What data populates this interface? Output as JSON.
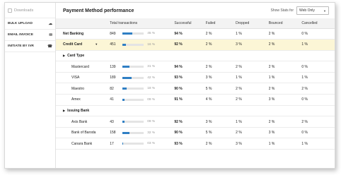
{
  "sidebar": {
    "top_label": "Downloads",
    "items": [
      {
        "label": "BULK UPLOAD",
        "icon": "cloud-upload-icon"
      },
      {
        "label": "EMAIL INVOICE",
        "icon": "email-icon"
      },
      {
        "label": "INITIATE BY IVR",
        "icon": "phone-icon"
      }
    ]
  },
  "header": {
    "title": "Payment Method performance",
    "stats_label": "Show Stats for",
    "stats_value": "Web Only"
  },
  "table": {
    "columns": [
      "",
      "Total transactions",
      "Successful",
      "Failed",
      "Dropped",
      "Bounced",
      "Cancelled"
    ],
    "rows": [
      {
        "kind": "main",
        "label": "Net Banking",
        "count": "849",
        "pct": "45 %",
        "frac": 0.45,
        "successful": "94 %",
        "failed": "2 %",
        "dropped": "1 %",
        "bounced": "2 %",
        "cancelled": "0 %"
      },
      {
        "kind": "highlight",
        "label": "Credit Card",
        "count": "451",
        "pct": "16 %",
        "frac": 0.16,
        "successful": "92 %",
        "failed": "2 %",
        "dropped": "3 %",
        "bounced": "2 %",
        "cancelled": "1 %"
      },
      {
        "kind": "group",
        "label": "Card Type"
      },
      {
        "kind": "sub",
        "label": "Mastercard",
        "count": "139",
        "pct": "31 %",
        "frac": 0.31,
        "successful": "94 %",
        "failed": "2 %",
        "dropped": "2 %",
        "bounced": "2 %",
        "cancelled": "0 %"
      },
      {
        "kind": "sub",
        "label": "VISA",
        "count": "189",
        "pct": "42 %",
        "frac": 0.42,
        "successful": "93 %",
        "failed": "3 %",
        "dropped": "1 %",
        "bounced": "1 %",
        "cancelled": "1 %"
      },
      {
        "kind": "sub",
        "label": "Maestro",
        "count": "82",
        "pct": "18 %",
        "frac": 0.18,
        "successful": "90 %",
        "failed": "5 %",
        "dropped": "2 %",
        "bounced": "2 %",
        "cancelled": "2 %"
      },
      {
        "kind": "sub",
        "label": "Amex",
        "count": "41",
        "pct": "09 %",
        "frac": 0.09,
        "successful": "91 %",
        "failed": "4 %",
        "dropped": "2 %",
        "bounced": "3 %",
        "cancelled": "0 %"
      },
      {
        "kind": "group",
        "label": "Issuing Bank"
      },
      {
        "kind": "sub",
        "label": "Axis Bank",
        "count": "43",
        "pct": "09 %",
        "frac": 0.09,
        "successful": "92 %",
        "failed": "3 %",
        "dropped": "1 %",
        "bounced": "2 %",
        "cancelled": "2 %"
      },
      {
        "kind": "sub",
        "label": "Bank of Baroda",
        "count": "158",
        "pct": "32 %",
        "frac": 0.32,
        "successful": "90 %",
        "failed": "5 %",
        "dropped": "2 %",
        "bounced": "3 %",
        "cancelled": "0 %"
      },
      {
        "kind": "sub",
        "label": "Canara Bank",
        "count": "17",
        "pct": "03 %",
        "frac": 0.03,
        "successful": "93 %",
        "failed": "2 %",
        "dropped": "3 %",
        "bounced": "1 %",
        "cancelled": "1 %"
      }
    ]
  },
  "colors": {
    "accent": "#2f7fc4",
    "highlight": "#fcf6d6",
    "header_bg": "#f3f3f3"
  }
}
